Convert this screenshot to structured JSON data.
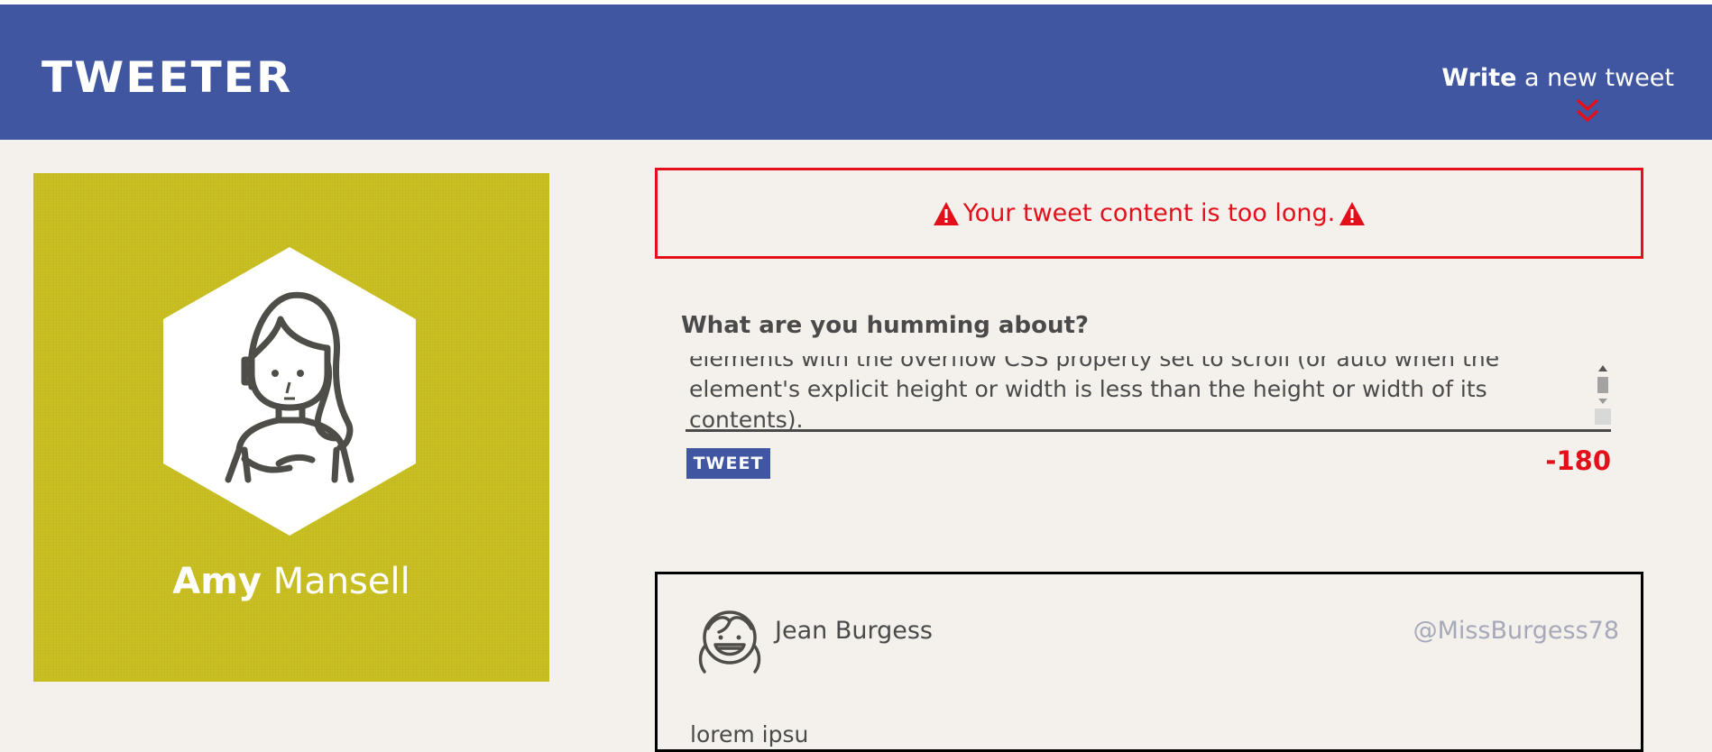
{
  "nav": {
    "logo": "TWEETER",
    "write_bold": "Write",
    "write_rest": " a new tweet",
    "chevron_icon": "double-chevron-down-icon",
    "chevron_color": "#e3101b"
  },
  "profile": {
    "first_name": "Amy",
    "last_name": " Mansell",
    "avatar_icon": "girl-avatar-icon",
    "card_color": "#c9bf23"
  },
  "error": {
    "message": "Your tweet content is too long.",
    "icon": "warning-icon",
    "color": "#e3101b"
  },
  "compose": {
    "label": "What are you humming about?",
    "text": "elements with the overflow CSS property set to scroll (or auto when the element's explicit height or width is less than the height or width of its contents).",
    "button_label": "TWEET",
    "counter": "-180"
  },
  "tweet": {
    "name": "Jean Burgess",
    "handle": "@MissBurgess78",
    "body": "lorem ipsu",
    "avatar_icon": "smiling-girl-avatar-icon"
  },
  "colors": {
    "nav": "#4056a1",
    "background": "#f4f1ed",
    "text": "#4a4a4a",
    "handle": "#a6a9b9"
  }
}
